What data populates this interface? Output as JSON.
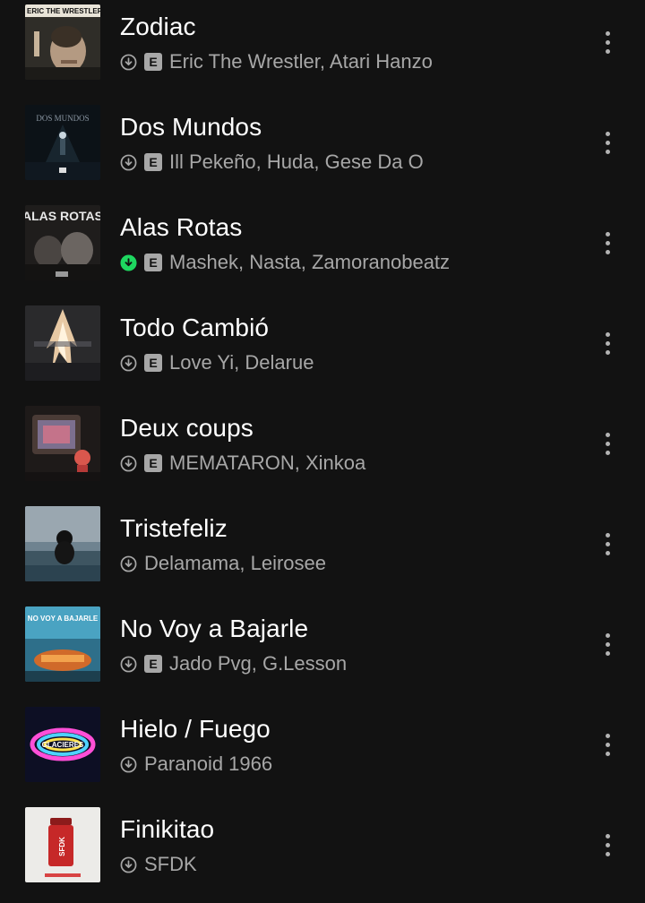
{
  "tracks": [
    {
      "title": "Zodiac",
      "artists": "Eric The Wrestler, Atari Hanzo",
      "explicit": true,
      "downloaded": false,
      "cover_text": "ERIC THE WRESTLER"
    },
    {
      "title": "Dos Mundos",
      "artists": "Ill Pekeño, Huda, Gese Da O",
      "explicit": true,
      "downloaded": false,
      "cover_text": "DOS MUNDOS"
    },
    {
      "title": "Alas Rotas",
      "artists": "Mashek, Nasta, Zamoranobeatz",
      "explicit": true,
      "downloaded": true,
      "cover_text": "ALAS ROTAS"
    },
    {
      "title": "Todo Cambió",
      "artists": "Love Yi, Delarue",
      "explicit": true,
      "downloaded": false,
      "cover_text": ""
    },
    {
      "title": "Deux coups",
      "artists": "MEMATARON, Xinkoa",
      "explicit": true,
      "downloaded": false,
      "cover_text": ""
    },
    {
      "title": "Tristefeliz",
      "artists": "Delamama, Leirosee",
      "explicit": false,
      "downloaded": false,
      "cover_text": ""
    },
    {
      "title": "No Voy a Bajarle",
      "artists": "Jado Pvg, G.Lesson",
      "explicit": true,
      "downloaded": false,
      "cover_text": "NO VOY A BAJARLE"
    },
    {
      "title": "Hielo / Fuego",
      "artists": "Paranoid 1966",
      "explicit": false,
      "downloaded": false,
      "cover_text": "GLACIERES"
    },
    {
      "title": "Finikitao",
      "artists": "SFDK",
      "explicit": false,
      "downloaded": false,
      "cover_text": "SFDK"
    }
  ],
  "explicit_label": "E",
  "icons": {
    "download": "download-circle-icon",
    "more": "more-vertical-icon"
  },
  "colors": {
    "background": "#121212",
    "title": "#ffffff",
    "subtitle": "#a7a7a7",
    "downloaded_accent": "#1ed760"
  }
}
